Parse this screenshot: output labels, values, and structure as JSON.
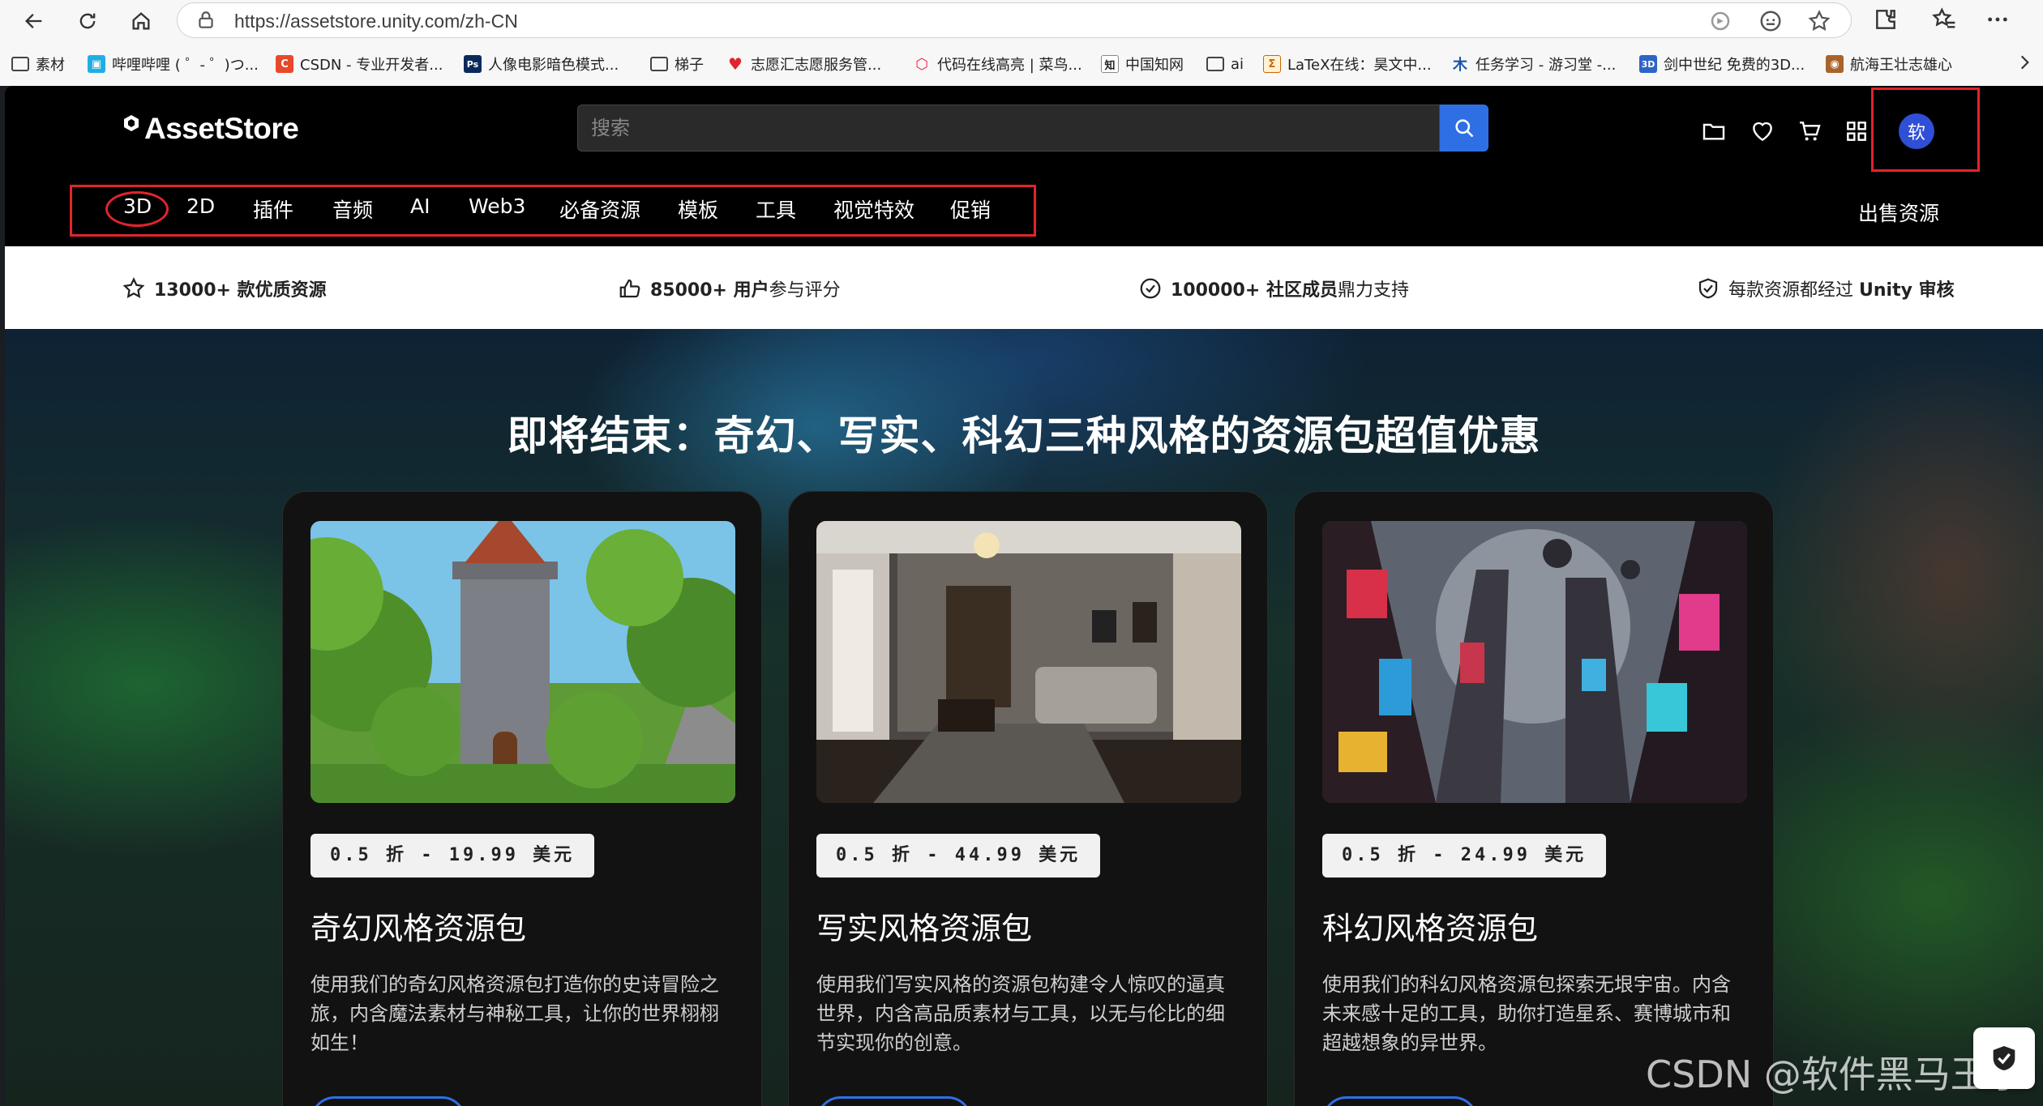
{
  "browser": {
    "url": "https://assetstore.unity.com/zh-CN",
    "bookmarks": [
      {
        "label": "素材",
        "icon": "folder-icon"
      },
      {
        "label": "哔哩哔哩 ( ゜- ゜)つ...",
        "icon": "bilibili-icon"
      },
      {
        "label": "CSDN - 专业开发者...",
        "icon": "csdn-icon"
      },
      {
        "label": "人像电影暗色模式...",
        "icon": "ps-icon"
      },
      {
        "label": "梯子",
        "icon": "folder-icon"
      },
      {
        "label": "志愿汇志愿服务管...",
        "icon": "heart-icon"
      },
      {
        "label": "代码在线高亮 | 菜鸟...",
        "icon": "cube-icon"
      },
      {
        "label": "中国知网",
        "icon": "cnki-icon"
      },
      {
        "label": "ai",
        "icon": "folder-icon"
      },
      {
        "label": "LaTeX在线：昊文中...",
        "icon": "latex-icon"
      },
      {
        "label": "任务学习 - 游习堂 -...",
        "icon": "tree-icon"
      },
      {
        "label": "剑中世纪 免费的3D...",
        "icon": "3d-icon"
      },
      {
        "label": "航海王壮志雄心",
        "icon": "game-icon"
      }
    ]
  },
  "header": {
    "logo": "AssetStore",
    "search_placeholder": "搜索",
    "avatar_text": "软",
    "sell_label": "出售资源",
    "categories": [
      "3D",
      "2D",
      "插件",
      "音频",
      "AI",
      "Web3",
      "必备资源",
      "模板",
      "工具",
      "视觉特效",
      "促销"
    ]
  },
  "trust": [
    {
      "bold": "13000+ 款优质资源",
      "rest": ""
    },
    {
      "bold": "85000+ 用户",
      "rest": "参与评分"
    },
    {
      "bold": "100000+ 社区成员",
      "rest": "鼎力支持"
    },
    {
      "bold": "Unity 审核",
      "pre": "每款资源都经过 "
    }
  ],
  "hero": {
    "title": "即将结束：奇幻、写实、科幻三种风格的资源包超值优惠",
    "cards": [
      {
        "price": "0.5 折 - 19.99 美元",
        "title": "奇幻风格资源包",
        "desc": "使用我们的奇幻风格资源包打造你的史诗冒险之旅，内含魔法素材与神秘工具，让你的世界栩栩如生！"
      },
      {
        "price": "0.5 折 - 44.99 美元",
        "title": "写实风格资源包",
        "desc": "使用我们写实风格的资源包构建令人惊叹的逼真世界，内含高品质素材与工具，以无与伦比的细节实现你的创意。"
      },
      {
        "price": "0.5 折 - 24.99 美元",
        "title": "科幻风格资源包",
        "desc": "使用我们的科幻风格资源包探索无垠宇宙。内含未来感十足的工具，助你打造星系、赛博城市和超越想象的异世界。"
      }
    ]
  },
  "watermark": "CSDN @软件黑马王子"
}
